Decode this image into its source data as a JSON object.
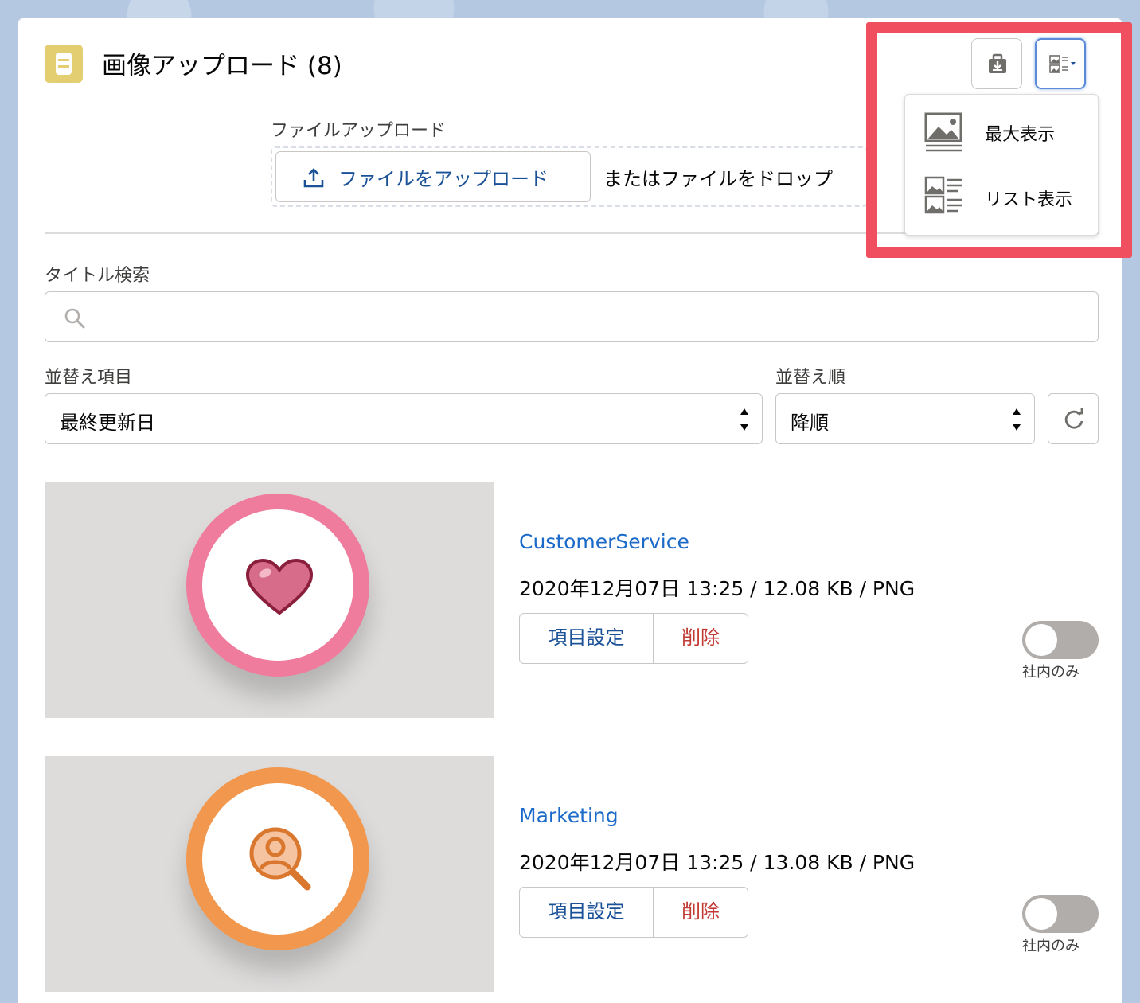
{
  "header": {
    "title": "画像アップロード (8)",
    "icon": "file-icon",
    "accent_color": "#e3cf71"
  },
  "toolbar": {
    "download_icon": "download-icon",
    "view_toggle_icon": "list-view-icon"
  },
  "view_menu": {
    "items": [
      {
        "label": "最大表示",
        "icon": "image-large-icon"
      },
      {
        "label": "リスト表示",
        "icon": "image-list-icon"
      }
    ]
  },
  "upload": {
    "label": "ファイルアップロード",
    "button_label": "ファイルをアップロード",
    "drop_text": "またはファイルをドロップ"
  },
  "search": {
    "label": "タイトル検索",
    "value": ""
  },
  "sort": {
    "field_label": "並替え項目",
    "field_value": "最終更新日",
    "order_label": "並替え順",
    "order_value": "降順"
  },
  "items": [
    {
      "title": "CustomerService",
      "meta": "2020年12月07日 13:25 / 12.08 KB / PNG",
      "settings_label": "項目設定",
      "delete_label": "削除",
      "toggle_label": "社内のみ",
      "toggle_on": false,
      "ring_color": "#ef7c9c",
      "icon": "heart-icon"
    },
    {
      "title": "Marketing",
      "meta": "2020年12月07日 13:25 / 13.08 KB / PNG",
      "settings_label": "項目設定",
      "delete_label": "削除",
      "toggle_label": "社内のみ",
      "toggle_on": false,
      "ring_color": "#f2984e",
      "icon": "person-search-icon"
    }
  ],
  "colors": {
    "link": "#1b6ac9",
    "delete": "#c23934",
    "highlight": "#ef4f5f"
  }
}
